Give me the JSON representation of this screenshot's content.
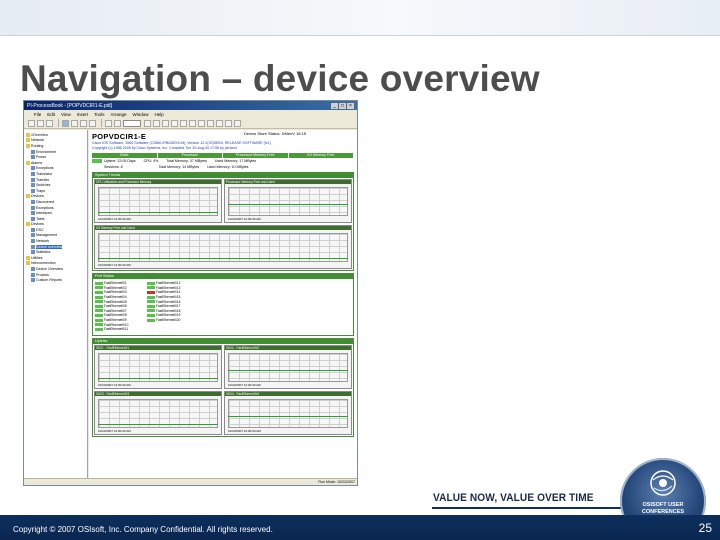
{
  "slide": {
    "title": "Navigation – device overview",
    "footer": "Copyright © 2007 OSIsoft, Inc. Company Confidential. All rights reserved.",
    "slide_number": "25",
    "tagline": "VALUE NOW, VALUE OVER TIME",
    "badge_text": "OSISOFT USER CONFERENCES",
    "colors": {
      "footer": "#0c2f5d",
      "title": "#4d4d4d",
      "section_green": "#3f8f32",
      "ok_green": "#59c24a"
    }
  },
  "window": {
    "title": "PI-ProcessBook - [POPVDCIR1-E.pdi]",
    "menu": [
      "File",
      "Edit",
      "View",
      "Insert",
      "Tools",
      "Arrange",
      "Window",
      "Help"
    ],
    "tree": [
      {
        "label": "\\\\Overview",
        "icon": "folder-icon"
      },
      {
        "label": "Network",
        "icon": "folder-icon"
      },
      {
        "label": "Routing",
        "icon": "folder-icon"
      },
      {
        "label": "Environment",
        "icon": "doc-icon"
      },
      {
        "label": "Power",
        "icon": "doc-icon"
      },
      {
        "label": "Alarms",
        "icon": "folder-icon"
      },
      {
        "label": "Exceptions",
        "icon": "doc-icon"
      },
      {
        "label": "Translator",
        "icon": "doc-icon"
      },
      {
        "label": "Transfer",
        "icon": "doc-icon"
      },
      {
        "label": "Switches",
        "icon": "doc-icon"
      },
      {
        "label": "Traps",
        "icon": "doc-icon"
      },
      {
        "label": "Devices",
        "icon": "folder-icon"
      },
      {
        "label": "Discovered",
        "icon": "doc-icon"
      },
      {
        "label": "Exceptions",
        "icon": "doc-icon"
      },
      {
        "label": "Interfaces",
        "icon": "doc-icon"
      },
      {
        "label": "Table",
        "icon": "doc-icon"
      },
      {
        "label": "Devices",
        "icon": "folder-icon"
      },
      {
        "label": "DSC",
        "icon": "doc-icon"
      },
      {
        "label": "Management",
        "icon": "doc-icon"
      },
      {
        "label": "Network",
        "icon": "doc-icon"
      },
      {
        "label": "Device overview",
        "icon": "doc-icon",
        "selected": true
      },
      {
        "label": "Statistics",
        "icon": "doc-icon"
      },
      {
        "label": "Utilities",
        "icon": "folder-icon"
      },
      {
        "label": "Interconnection",
        "icon": "folder-icon"
      },
      {
        "label": "Device Overview",
        "icon": "doc-icon"
      },
      {
        "label": "Process",
        "icon": "doc-icon"
      },
      {
        "label": "Custom Reports",
        "icon": "doc-icon"
      }
    ],
    "content": {
      "device_title": "POPVDCIR1-E",
      "device_status": "Device Store Status: DMenV 18:15",
      "info_lines": [
        "Cisco IOS Software, 3560 Software (C3560-IPBASEK9-M), Version 12.2(25)SEB4, RELEASE SOFTWARE (fc1)",
        "Copyright (c) 1986-2005 by Cisco Systems, Inc. Compiled Tue 30-Aug-05 17:56 by yenanh"
      ],
      "summary_headers": [
        "State",
        "Processor",
        "Processor Memory Free",
        "I/O Memory Free"
      ],
      "summary_rows": [
        [
          "Up",
          "Uptime: 22:05 Days",
          "CPU: 4%",
          "Total Memory: 37 MBytes",
          "Used Memory: 17 MBytes"
        ],
        [
          "",
          "Sessions: 8",
          "",
          "Total Memory: 14 MBytes",
          "Used Memory: 10 MBytes"
        ]
      ],
      "sections": {
        "system": "System Trends",
        "ports": "Port Status",
        "uplinks": "Uplinks"
      },
      "system_charts": [
        {
          "title": "CPU Utilization and Processor Memory",
          "footer": "10/23/2007 12:00:00 AM"
        },
        {
          "title": "Processor Memory Free and Used",
          "footer": "10/23/2007 12:00:00 AM"
        },
        {
          "title": "I/O Memory Free and Used",
          "footer": "10/23/2007 12:00:00 AM"
        }
      ],
      "uplink_charts": [
        {
          "title": "Gi0/1 - FastEthernet0/1",
          "footer": "10/23/2007 12:00:00 AM"
        },
        {
          "title": "Gi0/2 - FastEthernet0/2",
          "footer": "10/23/2007 12:00:00 AM"
        },
        {
          "title": "Gi0/3 - FastEthernet0/3",
          "footer": "10/23/2007 12:00:00 AM"
        },
        {
          "title": "Gi0/4 - FastEthernet0/4",
          "footer": "10/23/2007 12:00:00 AM"
        }
      ],
      "ports": [
        {
          "label": "FastEthernet0/1",
          "status": "up"
        },
        {
          "label": "FastEthernet0/2",
          "status": "up"
        },
        {
          "label": "FastEthernet0/3",
          "status": "up"
        },
        {
          "label": "FastEthernet0/4",
          "status": "up"
        },
        {
          "label": "FastEthernet0/5",
          "status": "up"
        },
        {
          "label": "FastEthernet0/6",
          "status": "up"
        },
        {
          "label": "FastEthernet0/7",
          "status": "up"
        },
        {
          "label": "FastEthernet0/8",
          "status": "up"
        },
        {
          "label": "FastEthernet0/9",
          "status": "up"
        },
        {
          "label": "FastEthernet0/10",
          "status": "up"
        },
        {
          "label": "FastEthernet0/11",
          "status": "up"
        },
        {
          "label": "FastEthernet0/12",
          "status": "up"
        },
        {
          "label": "FastEthernet0/13",
          "status": "up"
        },
        {
          "label": "FastEthernet0/14",
          "status": "down"
        },
        {
          "label": "FastEthernet0/15",
          "status": "up"
        },
        {
          "label": "FastEthernet0/16",
          "status": "up"
        },
        {
          "label": "FastEthernet0/17",
          "status": "up"
        },
        {
          "label": "FastEthernet0/18",
          "status": "up"
        },
        {
          "label": "FastEthernet0/19",
          "status": "up"
        },
        {
          "label": "FastEthernet0/20",
          "status": "up"
        }
      ]
    },
    "status_text": "Run Mode: 10/23/2007"
  }
}
